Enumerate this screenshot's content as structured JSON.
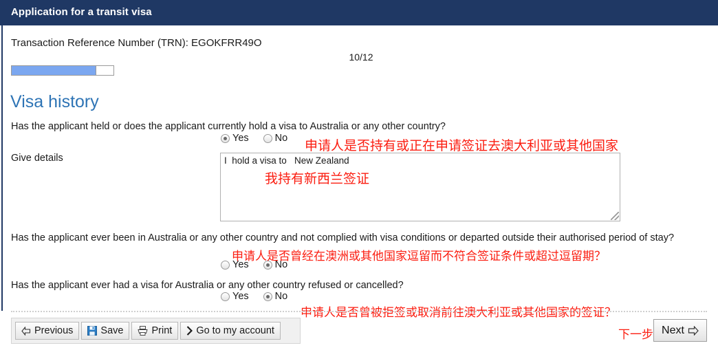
{
  "window": {
    "title": "Application for a transit visa",
    "header_color": "#1f3864"
  },
  "form": {
    "trn_line": "Transaction Reference Number (TRN): EGOKFRR49O",
    "page_counter": "10/12",
    "progress_percent": 83,
    "section_heading": "Visa history"
  },
  "questions": [
    {
      "id": "visa-held",
      "text": "Has the applicant held or does the applicant currently hold a visa to Australia or any other country?",
      "yes_label": "Yes",
      "no_label": "No",
      "selected": "Yes"
    },
    {
      "id": "not-complied",
      "text": "Has the applicant ever been in Australia or any other country and not complied with visa conditions or departed outside their authorised period of stay?",
      "yes_label": "Yes",
      "no_label": "No",
      "selected": "No"
    },
    {
      "id": "refused-cancelled",
      "text": "Has the applicant ever had a visa for Australia or any other country refused or cancelled?",
      "yes_label": "Yes",
      "no_label": "No",
      "selected": "No"
    }
  ],
  "details": {
    "label": "Give details",
    "value": "I  hold a visa to   New Zealand",
    "placeholder": ""
  },
  "annotations": {
    "color": "#fb1d10",
    "q1": "申请人是否持有或正在申请签证去澳大利亚或其他国家",
    "details": "我持有新西兰签证",
    "q2": "申请人是否曾经在澳洲或其他国家逗留而不符合签证条件或超过逗留期？",
    "q3": "申请人是否曾被拒签或取消前往澳大利亚或其他国家的签证？",
    "next": "下一步"
  },
  "toolbar": {
    "previous_label": "Previous",
    "save_label": "Save",
    "print_label": "Print",
    "account_label": "Go to my account",
    "next_label": "Next"
  }
}
